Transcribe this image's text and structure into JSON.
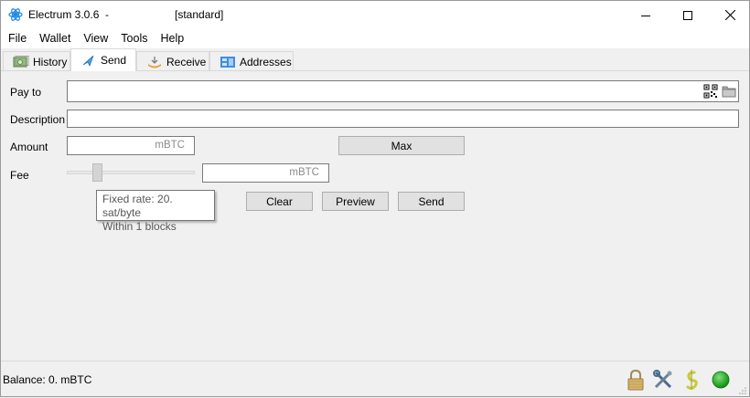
{
  "window": {
    "title": "Electrum 3.0.6  -",
    "wallet": "[standard]"
  },
  "menu": [
    "File",
    "Wallet",
    "View",
    "Tools",
    "Help"
  ],
  "tabs": [
    {
      "label": "History",
      "icon": "history-icon"
    },
    {
      "label": "Send",
      "icon": "send-icon",
      "active": true
    },
    {
      "label": "Receive",
      "icon": "receive-icon"
    },
    {
      "label": "Addresses",
      "icon": "addresses-icon"
    }
  ],
  "send_form": {
    "pay_to_label": "Pay to",
    "pay_to_value": "",
    "description_label": "Description",
    "description_value": "",
    "amount_label": "Amount",
    "amount_value": "",
    "amount_unit": "mBTC",
    "max_label": "Max",
    "fee_label": "Fee",
    "fee_value": "",
    "fee_unit": "mBTC",
    "fee_slider_level": 0.2,
    "clear_label": "Clear",
    "preview_label": "Preview",
    "send_label": "Send"
  },
  "tooltip": {
    "line1": "Fixed rate: 20. sat/byte",
    "line2": "Within 1 blocks"
  },
  "status": {
    "balance": "Balance: 0. mBTC",
    "icons": [
      "lock-icon",
      "preferences-icon",
      "seed-icon",
      "network-status-icon"
    ],
    "network_color": "#22b222"
  },
  "colors": {
    "accent": "#1e88e5",
    "window_bg": "#f0f0f0"
  }
}
